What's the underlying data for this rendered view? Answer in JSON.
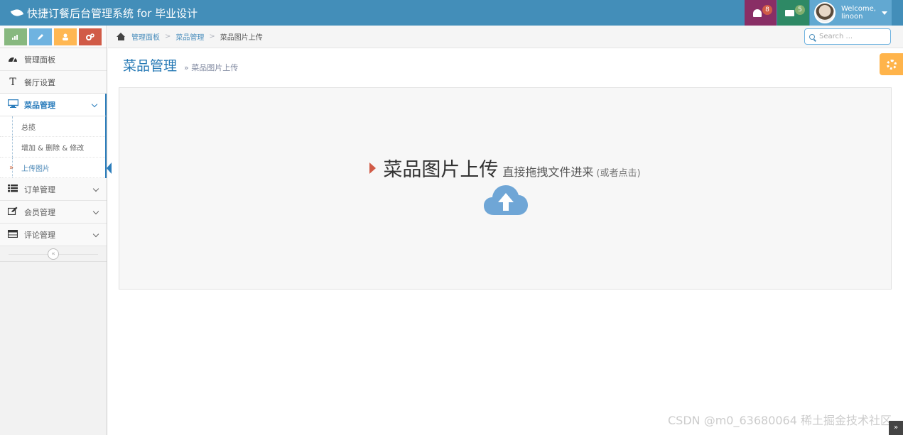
{
  "navbar": {
    "brand": "快捷订餐后台管理系统 for 毕业设计",
    "notifications_count": "8",
    "messages_count": "5",
    "welcome": "Welcome,",
    "username": "linoon"
  },
  "shortcuts": [
    "signal-icon",
    "pencil-icon",
    "group-icon",
    "cogs-icon"
  ],
  "sidebar": {
    "items": [
      {
        "label": "管理面板",
        "icon": "dashboard-icon"
      },
      {
        "label": "餐厅设置",
        "icon": "text-icon"
      },
      {
        "label": "菜品管理",
        "icon": "desktop-icon"
      },
      {
        "label": "订单管理",
        "icon": "list-icon"
      },
      {
        "label": "会员管理",
        "icon": "edit-icon"
      },
      {
        "label": "评论管理",
        "icon": "table-icon"
      }
    ],
    "submenu": [
      {
        "label": "总揽"
      },
      {
        "label": "增加 & 删除 & 修改"
      },
      {
        "label": "上传图片"
      }
    ]
  },
  "breadcrumbs": {
    "items": [
      "管理面板",
      "菜品管理"
    ],
    "current": "菜品图片上传"
  },
  "search": {
    "placeholder": "Search ..."
  },
  "page": {
    "title": "菜品管理",
    "subtitle": "» 菜品图片上传"
  },
  "dropzone": {
    "title": "菜品图片上传",
    "description": "直接拖拽文件进来",
    "hint": "(或者点击)"
  },
  "watermark": "CSDN @m0_63680064 稀土掘金技术社区"
}
